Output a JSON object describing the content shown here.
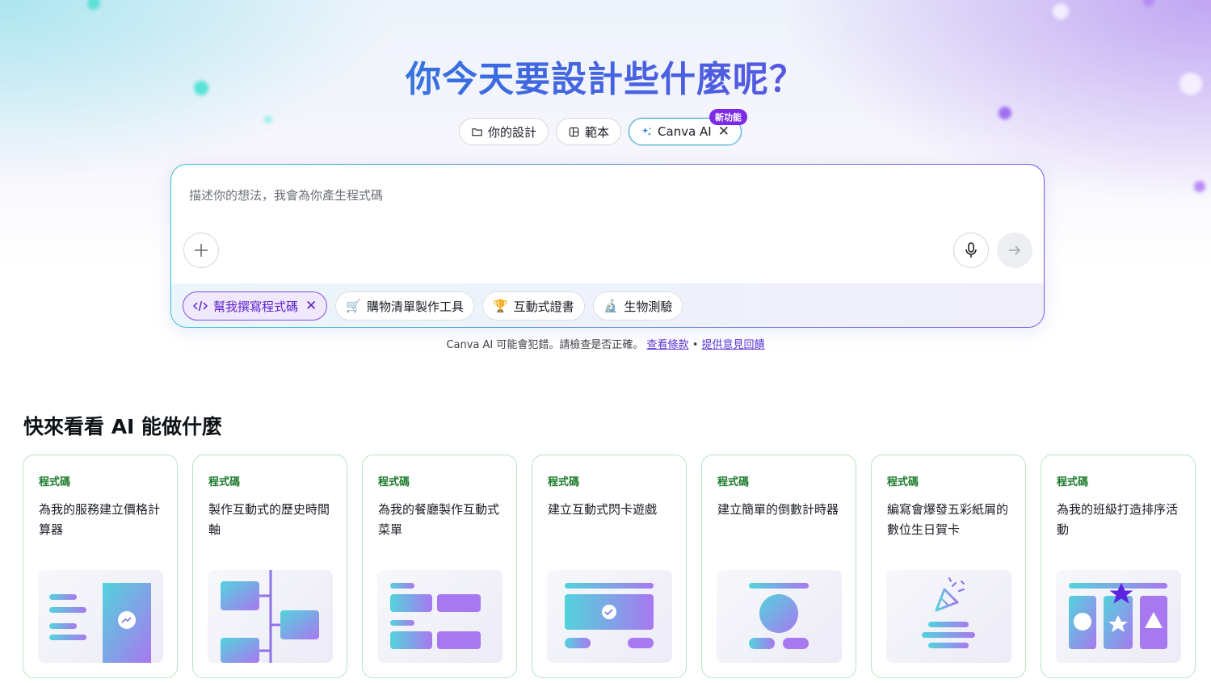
{
  "hero": {
    "title": "你今天要設計些什麼呢？"
  },
  "mode_tabs": [
    {
      "label": "你的設計",
      "icon": "folder-icon"
    },
    {
      "label": "範本",
      "icon": "template-icon"
    },
    {
      "label": "Canva AI",
      "icon": "sparkle-icon",
      "badge": "新功能",
      "active": true
    }
  ],
  "prompt": {
    "placeholder": "描述你的想法，我會為你產生程式碼",
    "add_icon": "plus-icon",
    "mic_icon": "microphone-icon",
    "send_icon": "arrow-right-icon"
  },
  "suggestion_chips": [
    {
      "label": "幫我撰寫程式碼",
      "icon": "code-icon",
      "selected": true
    },
    {
      "label": "購物清單製作工具",
      "icon": "cart-icon"
    },
    {
      "label": "互動式證書",
      "icon": "trophy-icon"
    },
    {
      "label": "生物測驗",
      "icon": "microscope-icon"
    }
  ],
  "disclaimer": {
    "text": "Canva AI 可能會犯錯。請檢查是否正確。",
    "terms_link": "查看條款",
    "separator": "•",
    "feedback_link": "提供意見回饋"
  },
  "section": {
    "title": "快來看看 AI 能做什麼"
  },
  "cards": [
    {
      "tag": "程式碼",
      "description": "為我的服務建立價格計算器",
      "art": "calculator"
    },
    {
      "tag": "程式碼",
      "description": "製作互動式的歷史時間軸",
      "art": "timeline"
    },
    {
      "tag": "程式碼",
      "description": "為我的餐廳製作互動式菜單",
      "art": "menu"
    },
    {
      "tag": "程式碼",
      "description": "建立互動式閃卡遊戲",
      "art": "flashcard"
    },
    {
      "tag": "程式碼",
      "description": "建立簡單的倒數計時器",
      "art": "timer"
    },
    {
      "tag": "程式碼",
      "description": "編寫會爆發五彩紙屑的數位生日賀卡",
      "art": "confetti"
    },
    {
      "tag": "程式碼",
      "description": "為我的班級打造排序活動",
      "art": "sorting"
    }
  ],
  "colors": {
    "accent_purple": "#7d2ae8",
    "accent_teal": "#2cb5c9",
    "tag_green": "#1b7a2a",
    "card_border": "#b9e4c3"
  }
}
